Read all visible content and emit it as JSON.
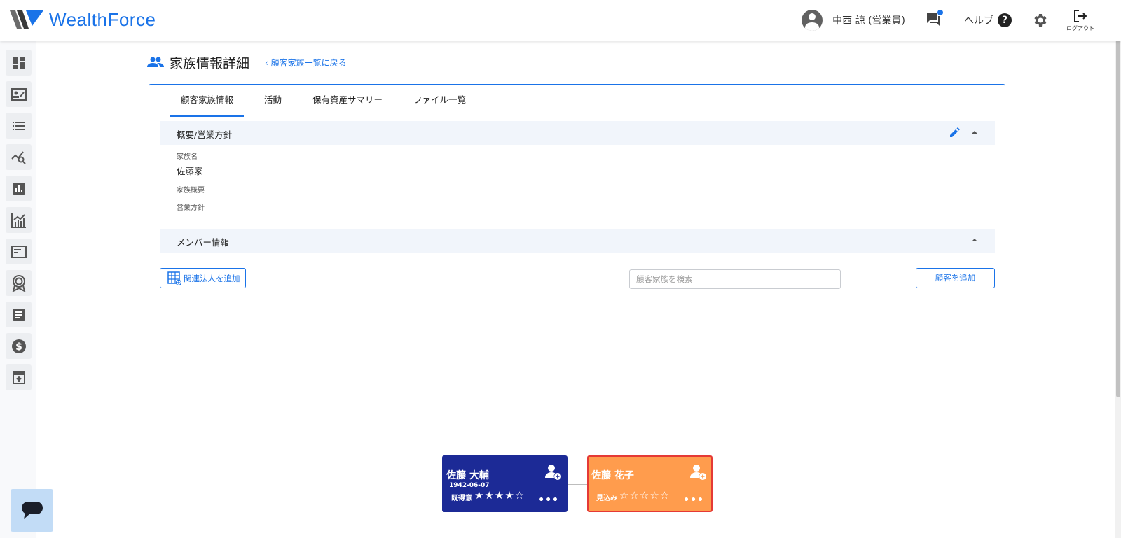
{
  "app": {
    "logo_text": "WealthForce"
  },
  "header": {
    "user_name": "中西 諒 (営業員)",
    "help_label": "ヘルプ",
    "help_glyph": "?",
    "logout_label": "ログアウト"
  },
  "sidebar": {
    "items": [
      {
        "icon": "dashboard-icon"
      },
      {
        "icon": "contact-card-icon"
      },
      {
        "icon": "list-icon"
      },
      {
        "icon": "analytics-search-icon"
      },
      {
        "icon": "bar-chart-icon"
      },
      {
        "icon": "growth-chart-icon"
      },
      {
        "icon": "document-icon"
      },
      {
        "icon": "award-icon"
      },
      {
        "icon": "notes-icon"
      },
      {
        "icon": "dollar-icon"
      },
      {
        "icon": "upload-icon"
      }
    ]
  },
  "page": {
    "title": "家族情報詳細",
    "back_link": "顧客家族一覧に戻る",
    "back_glyph": "‹"
  },
  "tabs": [
    {
      "label": "顧客家族情報",
      "active": true
    },
    {
      "label": "活動"
    },
    {
      "label": "保有資産サマリー"
    },
    {
      "label": "ファイル一覧"
    }
  ],
  "overview": {
    "title": "概要/営業方針",
    "family_name_label": "家族名",
    "family_name": "佐藤家",
    "family_summary_label": "家族概要",
    "sales_policy_label": "営業方針"
  },
  "members": {
    "title": "メンバー情報",
    "add_corp_button": "関連法人を追加",
    "search_placeholder": "顧客家族を検索",
    "add_customer_button": "顧客を追加",
    "cards": [
      {
        "name": "佐藤 大輔",
        "dob": "1942-06-07",
        "status": "既得意",
        "stars": "★★★★☆",
        "more": "•••",
        "color": "#1c2a96"
      },
      {
        "name": "佐藤 花子",
        "dob": "",
        "status": "見込み",
        "stars": "☆☆☆☆☆",
        "more": "•••",
        "color": "#ff9c4d"
      }
    ]
  },
  "colors": {
    "accent": "#1a73e8",
    "navy_card": "#1c2a96",
    "orange_card": "#ff9c4d",
    "selected_border": "#e53935"
  }
}
